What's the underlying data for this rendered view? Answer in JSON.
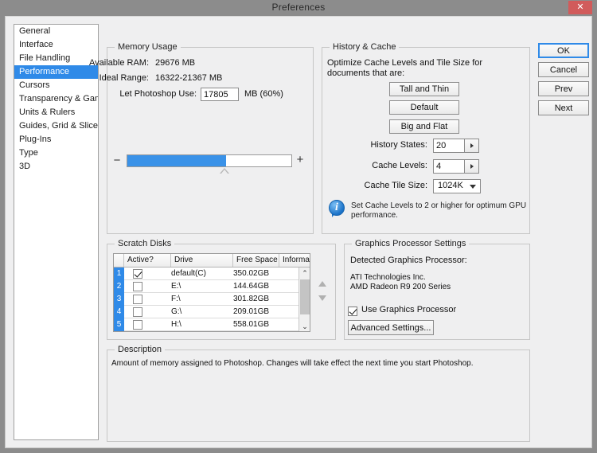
{
  "window": {
    "title": "Preferences",
    "close_label": "✕"
  },
  "colors": {
    "accent": "#2f8ae8",
    "slider_fill": "#3a92e8",
    "close_bg": "#d15b5b",
    "dialog_bg": "#efeff0",
    "titlebar_bg": "#8c8c8c"
  },
  "sidebar": {
    "items": [
      {
        "label": "General",
        "selected": false
      },
      {
        "label": "Interface",
        "selected": false
      },
      {
        "label": "File Handling",
        "selected": false
      },
      {
        "label": "Performance",
        "selected": true
      },
      {
        "label": "Cursors",
        "selected": false
      },
      {
        "label": "Transparency & Gamut",
        "selected": false
      },
      {
        "label": "Units & Rulers",
        "selected": false
      },
      {
        "label": "Guides, Grid & Slices",
        "selected": false
      },
      {
        "label": "Plug-Ins",
        "selected": false
      },
      {
        "label": "Type",
        "selected": false
      },
      {
        "label": "3D",
        "selected": false
      }
    ]
  },
  "memory_usage": {
    "group_label": "Memory Usage",
    "available_ram_label": "Available RAM:",
    "available_ram_value": "29676 MB",
    "ideal_range_label": "Ideal Range:",
    "ideal_range_value": "16322-21367 MB",
    "let_use_label": "Let Photoshop Use:",
    "let_use_value": "17805",
    "let_use_suffix": "MB (60%)",
    "slider_percent": 60,
    "slider_minus": "−",
    "slider_plus": "+"
  },
  "history_cache": {
    "group_label": "History & Cache",
    "intro_line1": "Optimize Cache Levels and Tile Size for",
    "intro_line2": "documents that are:",
    "preset_tall": "Tall and Thin",
    "preset_default": "Default",
    "preset_big": "Big and Flat",
    "history_states_label": "History States:",
    "history_states_value": "20",
    "cache_levels_label": "Cache Levels:",
    "cache_levels_value": "4",
    "cache_tile_label": "Cache Tile Size:",
    "cache_tile_value": "1024K",
    "info_line1": "Set Cache Levels to 2 or higher for optimum GPU",
    "info_line2": "performance.",
    "info_glyph": "i"
  },
  "scratch_disks": {
    "group_label": "Scratch Disks",
    "columns": [
      "",
      "Active?",
      "Drive",
      "Free Space",
      "Information"
    ],
    "rows": [
      {
        "num": "1",
        "active": true,
        "drive": "default(C)",
        "free_space": "350.02GB",
        "information": ""
      },
      {
        "num": "2",
        "active": false,
        "drive": "E:\\",
        "free_space": "144.64GB",
        "information": ""
      },
      {
        "num": "3",
        "active": false,
        "drive": "F:\\",
        "free_space": "301.82GB",
        "information": ""
      },
      {
        "num": "4",
        "active": false,
        "drive": "G:\\",
        "free_space": "209.01GB",
        "information": ""
      },
      {
        "num": "5",
        "active": false,
        "drive": "H:\\",
        "free_space": "558.01GB",
        "information": ""
      }
    ],
    "scroll_up": "⌃",
    "scroll_down": "⌄"
  },
  "graphics_processor": {
    "group_label": "Graphics Processor Settings",
    "detected_label": "Detected Graphics Processor:",
    "vendor": "ATI Technologies Inc.",
    "model": "AMD Radeon R9 200 Series",
    "use_gpu_label": "Use Graphics Processor",
    "use_gpu_checked": true,
    "advanced_button": "Advanced Settings..."
  },
  "description": {
    "group_label": "Description",
    "text": "Amount of memory assigned to Photoshop. Changes will take effect the next time you start Photoshop."
  },
  "buttons": {
    "ok": "OK",
    "cancel": "Cancel",
    "prev": "Prev",
    "next": "Next"
  }
}
